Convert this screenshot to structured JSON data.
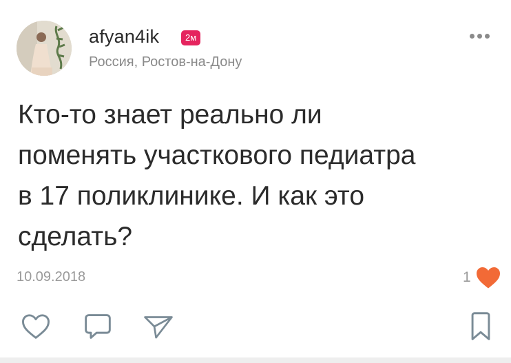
{
  "post": {
    "author": {
      "username": "afyan4ik",
      "time_badge": "2м",
      "location": "Россия, Ростов-на-Дону"
    },
    "text": "Кто-то знает реально ли\nпоменять участкового педиатра\nв 17 поликлинике.  И как это\nсделать?",
    "date": "10.09.2018",
    "likes_count": "1"
  },
  "icons": {
    "more": "more-dots-icon",
    "like_filled": "heart-filled-icon",
    "like": "heart-outline-icon",
    "comment": "comment-bubble-icon",
    "share": "paper-plane-icon",
    "save": "bookmark-icon"
  },
  "colors": {
    "badge": "#e5245e",
    "like_filled": "#f26a36",
    "icon_stroke": "#7a8b96",
    "secondary_text": "#8a8a8a"
  }
}
